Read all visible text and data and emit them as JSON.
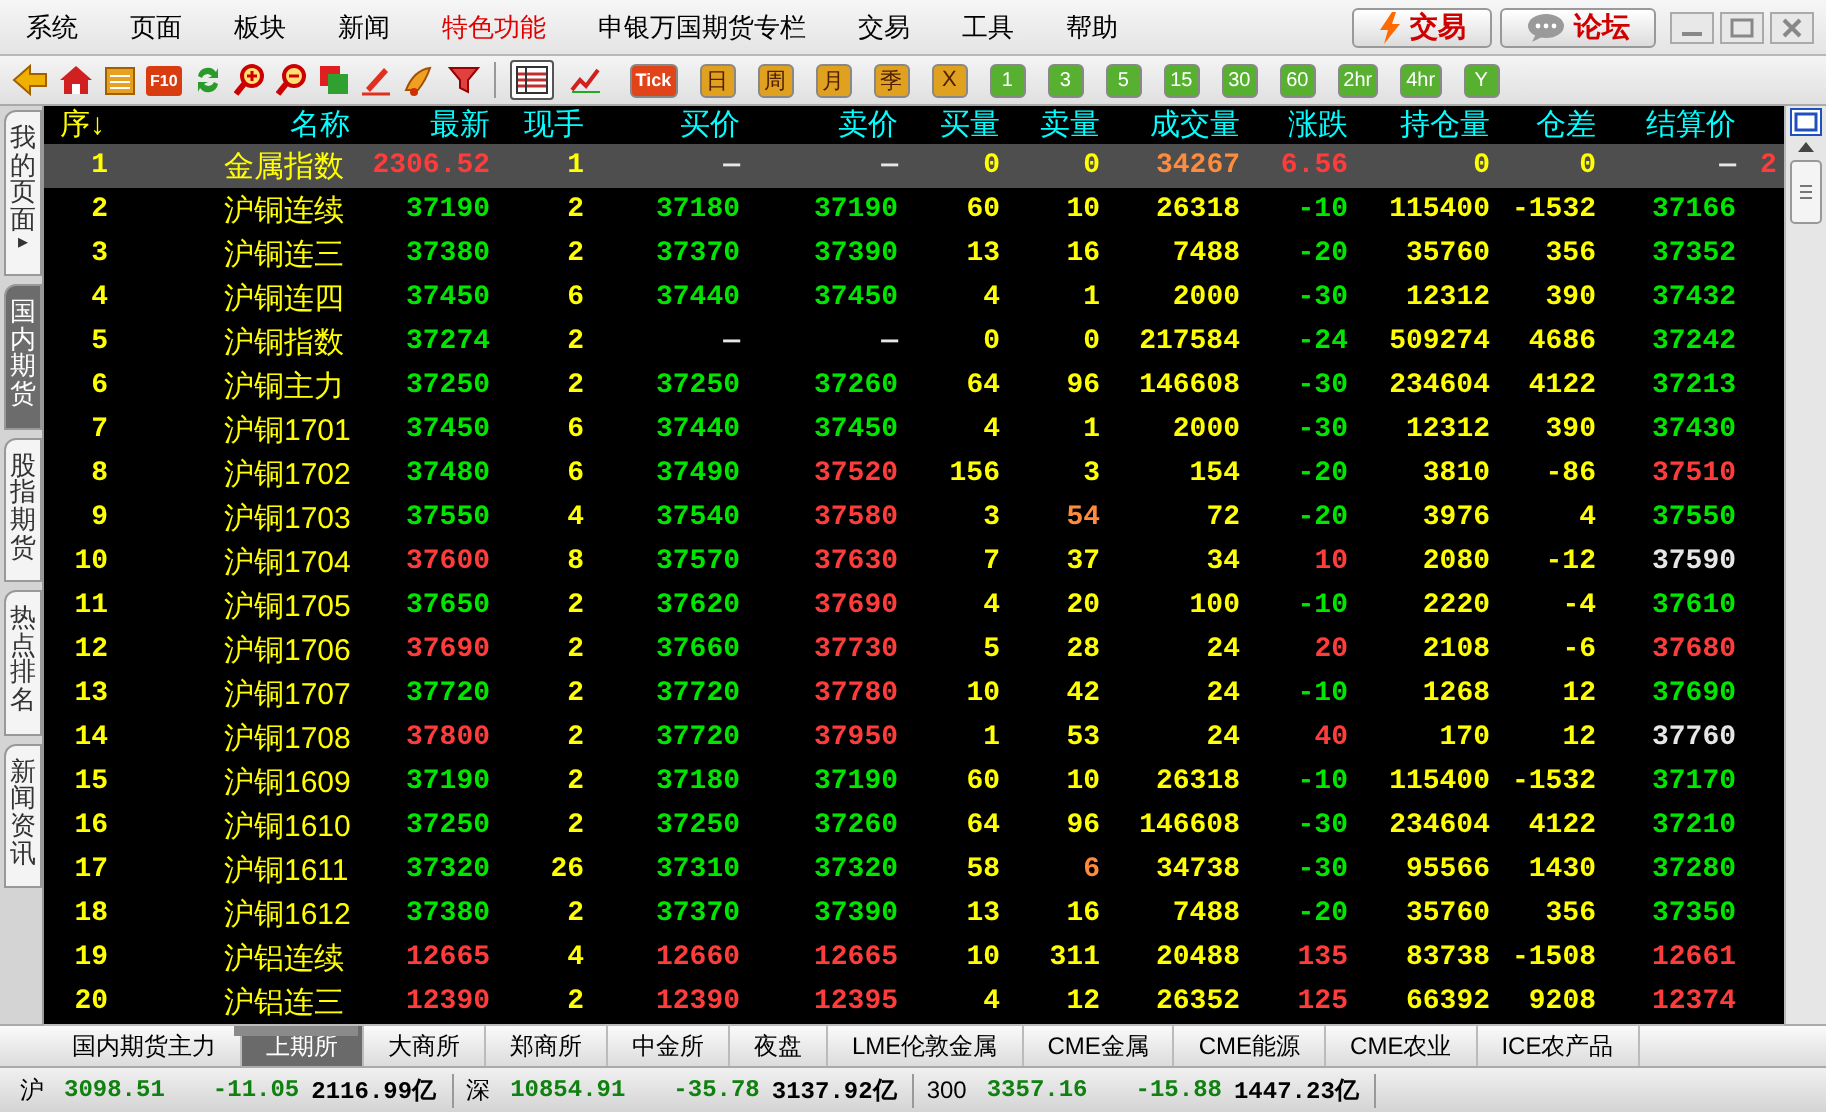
{
  "menu": [
    {
      "label": "系统",
      "highlight": false
    },
    {
      "label": "页面",
      "highlight": false
    },
    {
      "label": "板块",
      "highlight": false
    },
    {
      "label": "新闻",
      "highlight": false
    },
    {
      "label": "特色功能",
      "highlight": true
    },
    {
      "label": "申银万国期货专栏",
      "highlight": false
    },
    {
      "label": "交易",
      "highlight": false
    },
    {
      "label": "工具",
      "highlight": false
    },
    {
      "label": "帮助",
      "highlight": false
    }
  ],
  "top_buttons": [
    {
      "label": "交易",
      "kind": "trade"
    },
    {
      "label": "论坛",
      "kind": "forum"
    }
  ],
  "toolbar": {
    "f10": "F10",
    "view_buttons": [
      {
        "selected": true
      },
      {
        "selected": false
      }
    ],
    "periods": [
      {
        "label": "Tick",
        "kind": "tick"
      },
      {
        "label": "日",
        "kind": "day"
      },
      {
        "label": "周",
        "kind": "day"
      },
      {
        "label": "月",
        "kind": "day"
      },
      {
        "label": "季",
        "kind": "day"
      },
      {
        "label": "X",
        "kind": "day"
      },
      {
        "label": "1",
        "kind": "minute"
      },
      {
        "label": "3",
        "kind": "minute"
      },
      {
        "label": "5",
        "kind": "minute"
      },
      {
        "label": "15",
        "kind": "minute"
      },
      {
        "label": "30",
        "kind": "minute"
      },
      {
        "label": "60",
        "kind": "minute"
      },
      {
        "label": "2hr",
        "kind": "minute"
      },
      {
        "label": "4hr",
        "kind": "minute"
      },
      {
        "label": "Y",
        "kind": "minute"
      }
    ]
  },
  "side_tabs": [
    {
      "label": "我的页面",
      "arrow": "▸",
      "selected": false
    },
    {
      "label": "国内期货",
      "selected": true
    },
    {
      "label": "股指期货",
      "selected": false
    },
    {
      "label": "热点排名",
      "selected": false
    },
    {
      "label": "新闻资讯",
      "selected": false
    }
  ],
  "table": {
    "columns": [
      {
        "label": "序↓",
        "kind": "sort"
      },
      {
        "label": "名称",
        "kind": "field"
      },
      {
        "label": "最新",
        "kind": "field"
      },
      {
        "label": "现手",
        "kind": "field"
      },
      {
        "label": "买价",
        "kind": "field"
      },
      {
        "label": "卖价",
        "kind": "field"
      },
      {
        "label": "买量",
        "kind": "field"
      },
      {
        "label": "卖量",
        "kind": "field"
      },
      {
        "label": "成交量",
        "kind": "field"
      },
      {
        "label": "涨跌",
        "kind": "field"
      },
      {
        "label": "持仓量",
        "kind": "field"
      },
      {
        "label": "仓差",
        "kind": "field"
      },
      {
        "label": "结算价",
        "kind": "field"
      }
    ],
    "rows": [
      {
        "selected": true,
        "cells": [
          {
            "text": "1",
            "kind": "plain"
          },
          {
            "text": "金属指数",
            "kind": "plain"
          },
          {
            "text": "2306.52",
            "kind": "rise"
          },
          {
            "text": "1",
            "kind": "plain"
          },
          {
            "text": "—",
            "kind": "even"
          },
          {
            "text": "—",
            "kind": "even"
          },
          {
            "text": "0",
            "kind": "plain"
          },
          {
            "text": "0",
            "kind": "plain"
          },
          {
            "text": "34267",
            "kind": "alert"
          },
          {
            "text": "6.56",
            "kind": "rise"
          },
          {
            "text": "0",
            "kind": "plain"
          },
          {
            "text": "0",
            "kind": "plain"
          },
          {
            "text": "—",
            "kind": "even"
          },
          {
            "text": "2",
            "kind": "rise"
          }
        ]
      },
      {
        "selected": false,
        "cells": [
          {
            "text": "2",
            "kind": "plain"
          },
          {
            "text": "沪铜连续",
            "kind": "plain"
          },
          {
            "text": "37190",
            "kind": "fall"
          },
          {
            "text": "2",
            "kind": "plain"
          },
          {
            "text": "37180",
            "kind": "fall"
          },
          {
            "text": "37190",
            "kind": "fall"
          },
          {
            "text": "60",
            "kind": "plain"
          },
          {
            "text": "10",
            "kind": "plain"
          },
          {
            "text": "26318",
            "kind": "plain"
          },
          {
            "text": "-10",
            "kind": "fall"
          },
          {
            "text": "115400",
            "kind": "plain"
          },
          {
            "text": "-1532",
            "kind": "plain"
          },
          {
            "text": "37166",
            "kind": "fall"
          }
        ]
      },
      {
        "selected": false,
        "cells": [
          {
            "text": "3",
            "kind": "plain"
          },
          {
            "text": "沪铜连三",
            "kind": "plain"
          },
          {
            "text": "37380",
            "kind": "fall"
          },
          {
            "text": "2",
            "kind": "plain"
          },
          {
            "text": "37370",
            "kind": "fall"
          },
          {
            "text": "37390",
            "kind": "fall"
          },
          {
            "text": "13",
            "kind": "plain"
          },
          {
            "text": "16",
            "kind": "plain"
          },
          {
            "text": "7488",
            "kind": "plain"
          },
          {
            "text": "-20",
            "kind": "fall"
          },
          {
            "text": "35760",
            "kind": "plain"
          },
          {
            "text": "356",
            "kind": "plain"
          },
          {
            "text": "37352",
            "kind": "fall"
          }
        ]
      },
      {
        "selected": false,
        "cells": [
          {
            "text": "4",
            "kind": "plain"
          },
          {
            "text": "沪铜连四",
            "kind": "plain"
          },
          {
            "text": "37450",
            "kind": "fall"
          },
          {
            "text": "6",
            "kind": "plain"
          },
          {
            "text": "37440",
            "kind": "fall"
          },
          {
            "text": "37450",
            "kind": "fall"
          },
          {
            "text": "4",
            "kind": "plain"
          },
          {
            "text": "1",
            "kind": "plain"
          },
          {
            "text": "2000",
            "kind": "plain"
          },
          {
            "text": "-30",
            "kind": "fall"
          },
          {
            "text": "12312",
            "kind": "plain"
          },
          {
            "text": "390",
            "kind": "plain"
          },
          {
            "text": "37432",
            "kind": "fall"
          }
        ]
      },
      {
        "selected": false,
        "cells": [
          {
            "text": "5",
            "kind": "plain"
          },
          {
            "text": "沪铜指数",
            "kind": "plain"
          },
          {
            "text": "37274",
            "kind": "fall"
          },
          {
            "text": "2",
            "kind": "plain"
          },
          {
            "text": "—",
            "kind": "even"
          },
          {
            "text": "—",
            "kind": "even"
          },
          {
            "text": "0",
            "kind": "plain"
          },
          {
            "text": "0",
            "kind": "plain"
          },
          {
            "text": "217584",
            "kind": "plain"
          },
          {
            "text": "-24",
            "kind": "fall"
          },
          {
            "text": "509274",
            "kind": "plain"
          },
          {
            "text": "4686",
            "kind": "plain"
          },
          {
            "text": "37242",
            "kind": "fall"
          }
        ]
      },
      {
        "selected": false,
        "cells": [
          {
            "text": "6",
            "kind": "plain"
          },
          {
            "text": "沪铜主力",
            "kind": "plain"
          },
          {
            "text": "37250",
            "kind": "fall"
          },
          {
            "text": "2",
            "kind": "plain"
          },
          {
            "text": "37250",
            "kind": "fall"
          },
          {
            "text": "37260",
            "kind": "fall"
          },
          {
            "text": "64",
            "kind": "plain"
          },
          {
            "text": "96",
            "kind": "plain"
          },
          {
            "text": "146608",
            "kind": "plain"
          },
          {
            "text": "-30",
            "kind": "fall"
          },
          {
            "text": "234604",
            "kind": "plain"
          },
          {
            "text": "4122",
            "kind": "plain"
          },
          {
            "text": "37213",
            "kind": "fall"
          }
        ]
      },
      {
        "selected": false,
        "cells": [
          {
            "text": "7",
            "kind": "plain"
          },
          {
            "text": "沪铜1701",
            "kind": "plain"
          },
          {
            "text": "37450",
            "kind": "fall"
          },
          {
            "text": "6",
            "kind": "plain"
          },
          {
            "text": "37440",
            "kind": "fall"
          },
          {
            "text": "37450",
            "kind": "fall"
          },
          {
            "text": "4",
            "kind": "plain"
          },
          {
            "text": "1",
            "kind": "plain"
          },
          {
            "text": "2000",
            "kind": "plain"
          },
          {
            "text": "-30",
            "kind": "fall"
          },
          {
            "text": "12312",
            "kind": "plain"
          },
          {
            "text": "390",
            "kind": "plain"
          },
          {
            "text": "37430",
            "kind": "fall"
          }
        ]
      },
      {
        "selected": false,
        "cells": [
          {
            "text": "8",
            "kind": "plain"
          },
          {
            "text": "沪铜1702",
            "kind": "plain"
          },
          {
            "text": "37480",
            "kind": "fall"
          },
          {
            "text": "6",
            "kind": "plain"
          },
          {
            "text": "37490",
            "kind": "fall"
          },
          {
            "text": "37520",
            "kind": "rise"
          },
          {
            "text": "156",
            "kind": "plain"
          },
          {
            "text": "3",
            "kind": "plain"
          },
          {
            "text": "154",
            "kind": "plain"
          },
          {
            "text": "-20",
            "kind": "fall"
          },
          {
            "text": "3810",
            "kind": "plain"
          },
          {
            "text": "-86",
            "kind": "plain"
          },
          {
            "text": "37510",
            "kind": "rise"
          }
        ]
      },
      {
        "selected": false,
        "cells": [
          {
            "text": "9",
            "kind": "plain"
          },
          {
            "text": "沪铜1703",
            "kind": "plain"
          },
          {
            "text": "37550",
            "kind": "fall"
          },
          {
            "text": "4",
            "kind": "plain"
          },
          {
            "text": "37540",
            "kind": "fall"
          },
          {
            "text": "37580",
            "kind": "rise"
          },
          {
            "text": "3",
            "kind": "plain"
          },
          {
            "text": "54",
            "kind": "alert"
          },
          {
            "text": "72",
            "kind": "plain"
          },
          {
            "text": "-20",
            "kind": "fall"
          },
          {
            "text": "3976",
            "kind": "plain"
          },
          {
            "text": "4",
            "kind": "plain"
          },
          {
            "text": "37550",
            "kind": "fall"
          }
        ]
      },
      {
        "selected": false,
        "cells": [
          {
            "text": "10",
            "kind": "plain"
          },
          {
            "text": "沪铜1704",
            "kind": "plain"
          },
          {
            "text": "37600",
            "kind": "rise"
          },
          {
            "text": "8",
            "kind": "plain"
          },
          {
            "text": "37570",
            "kind": "fall"
          },
          {
            "text": "37630",
            "kind": "rise"
          },
          {
            "text": "7",
            "kind": "plain"
          },
          {
            "text": "37",
            "kind": "plain"
          },
          {
            "text": "34",
            "kind": "plain"
          },
          {
            "text": "10",
            "kind": "rise"
          },
          {
            "text": "2080",
            "kind": "plain"
          },
          {
            "text": "-12",
            "kind": "plain"
          },
          {
            "text": "37590",
            "kind": "even"
          }
        ]
      },
      {
        "selected": false,
        "cells": [
          {
            "text": "11",
            "kind": "plain"
          },
          {
            "text": "沪铜1705",
            "kind": "plain"
          },
          {
            "text": "37650",
            "kind": "fall"
          },
          {
            "text": "2",
            "kind": "plain"
          },
          {
            "text": "37620",
            "kind": "fall"
          },
          {
            "text": "37690",
            "kind": "rise"
          },
          {
            "text": "4",
            "kind": "plain"
          },
          {
            "text": "20",
            "kind": "plain"
          },
          {
            "text": "100",
            "kind": "plain"
          },
          {
            "text": "-10",
            "kind": "fall"
          },
          {
            "text": "2220",
            "kind": "plain"
          },
          {
            "text": "-4",
            "kind": "plain"
          },
          {
            "text": "37610",
            "kind": "fall"
          }
        ]
      },
      {
        "selected": false,
        "cells": [
          {
            "text": "12",
            "kind": "plain"
          },
          {
            "text": "沪铜1706",
            "kind": "plain"
          },
          {
            "text": "37690",
            "kind": "rise"
          },
          {
            "text": "2",
            "kind": "plain"
          },
          {
            "text": "37660",
            "kind": "fall"
          },
          {
            "text": "37730",
            "kind": "rise"
          },
          {
            "text": "5",
            "kind": "plain"
          },
          {
            "text": "28",
            "kind": "plain"
          },
          {
            "text": "24",
            "kind": "plain"
          },
          {
            "text": "20",
            "kind": "rise"
          },
          {
            "text": "2108",
            "kind": "plain"
          },
          {
            "text": "-6",
            "kind": "plain"
          },
          {
            "text": "37680",
            "kind": "rise"
          }
        ]
      },
      {
        "selected": false,
        "cells": [
          {
            "text": "13",
            "kind": "plain"
          },
          {
            "text": "沪铜1707",
            "kind": "plain"
          },
          {
            "text": "37720",
            "kind": "fall"
          },
          {
            "text": "2",
            "kind": "plain"
          },
          {
            "text": "37720",
            "kind": "fall"
          },
          {
            "text": "37780",
            "kind": "rise"
          },
          {
            "text": "10",
            "kind": "plain"
          },
          {
            "text": "42",
            "kind": "plain"
          },
          {
            "text": "24",
            "kind": "plain"
          },
          {
            "text": "-10",
            "kind": "fall"
          },
          {
            "text": "1268",
            "kind": "plain"
          },
          {
            "text": "12",
            "kind": "plain"
          },
          {
            "text": "37690",
            "kind": "fall"
          }
        ]
      },
      {
        "selected": false,
        "cells": [
          {
            "text": "14",
            "kind": "plain"
          },
          {
            "text": "沪铜1708",
            "kind": "plain"
          },
          {
            "text": "37800",
            "kind": "rise"
          },
          {
            "text": "2",
            "kind": "plain"
          },
          {
            "text": "37720",
            "kind": "fall"
          },
          {
            "text": "37950",
            "kind": "rise"
          },
          {
            "text": "1",
            "kind": "plain"
          },
          {
            "text": "53",
            "kind": "plain"
          },
          {
            "text": "24",
            "kind": "plain"
          },
          {
            "text": "40",
            "kind": "rise"
          },
          {
            "text": "170",
            "kind": "plain"
          },
          {
            "text": "12",
            "kind": "plain"
          },
          {
            "text": "37760",
            "kind": "even"
          }
        ]
      },
      {
        "selected": false,
        "cells": [
          {
            "text": "15",
            "kind": "plain"
          },
          {
            "text": "沪铜1609",
            "kind": "plain"
          },
          {
            "text": "37190",
            "kind": "fall"
          },
          {
            "text": "2",
            "kind": "plain"
          },
          {
            "text": "37180",
            "kind": "fall"
          },
          {
            "text": "37190",
            "kind": "fall"
          },
          {
            "text": "60",
            "kind": "plain"
          },
          {
            "text": "10",
            "kind": "plain"
          },
          {
            "text": "26318",
            "kind": "plain"
          },
          {
            "text": "-10",
            "kind": "fall"
          },
          {
            "text": "115400",
            "kind": "plain"
          },
          {
            "text": "-1532",
            "kind": "plain"
          },
          {
            "text": "37170",
            "kind": "fall"
          }
        ]
      },
      {
        "selected": false,
        "cells": [
          {
            "text": "16",
            "kind": "plain"
          },
          {
            "text": "沪铜1610",
            "kind": "plain"
          },
          {
            "text": "37250",
            "kind": "fall"
          },
          {
            "text": "2",
            "kind": "plain"
          },
          {
            "text": "37250",
            "kind": "fall"
          },
          {
            "text": "37260",
            "kind": "fall"
          },
          {
            "text": "64",
            "kind": "plain"
          },
          {
            "text": "96",
            "kind": "plain"
          },
          {
            "text": "146608",
            "kind": "plain"
          },
          {
            "text": "-30",
            "kind": "fall"
          },
          {
            "text": "234604",
            "kind": "plain"
          },
          {
            "text": "4122",
            "kind": "plain"
          },
          {
            "text": "37210",
            "kind": "fall"
          }
        ]
      },
      {
        "selected": false,
        "cells": [
          {
            "text": "17",
            "kind": "plain"
          },
          {
            "text": "沪铜1611",
            "kind": "plain"
          },
          {
            "text": "37320",
            "kind": "fall"
          },
          {
            "text": "26",
            "kind": "plain"
          },
          {
            "text": "37310",
            "kind": "fall"
          },
          {
            "text": "37320",
            "kind": "fall"
          },
          {
            "text": "58",
            "kind": "plain"
          },
          {
            "text": "6",
            "kind": "alert"
          },
          {
            "text": "34738",
            "kind": "plain"
          },
          {
            "text": "-30",
            "kind": "fall"
          },
          {
            "text": "95566",
            "kind": "plain"
          },
          {
            "text": "1430",
            "kind": "plain"
          },
          {
            "text": "37280",
            "kind": "fall"
          }
        ]
      },
      {
        "selected": false,
        "cells": [
          {
            "text": "18",
            "kind": "plain"
          },
          {
            "text": "沪铜1612",
            "kind": "plain"
          },
          {
            "text": "37380",
            "kind": "fall"
          },
          {
            "text": "2",
            "kind": "plain"
          },
          {
            "text": "37370",
            "kind": "fall"
          },
          {
            "text": "37390",
            "kind": "fall"
          },
          {
            "text": "13",
            "kind": "plain"
          },
          {
            "text": "16",
            "kind": "plain"
          },
          {
            "text": "7488",
            "kind": "plain"
          },
          {
            "text": "-20",
            "kind": "fall"
          },
          {
            "text": "35760",
            "kind": "plain"
          },
          {
            "text": "356",
            "kind": "plain"
          },
          {
            "text": "37350",
            "kind": "fall"
          }
        ]
      },
      {
        "selected": false,
        "cells": [
          {
            "text": "19",
            "kind": "plain"
          },
          {
            "text": "沪铝连续",
            "kind": "plain"
          },
          {
            "text": "12665",
            "kind": "rise"
          },
          {
            "text": "4",
            "kind": "plain"
          },
          {
            "text": "12660",
            "kind": "rise"
          },
          {
            "text": "12665",
            "kind": "rise"
          },
          {
            "text": "10",
            "kind": "plain"
          },
          {
            "text": "311",
            "kind": "plain"
          },
          {
            "text": "20488",
            "kind": "plain"
          },
          {
            "text": "135",
            "kind": "rise"
          },
          {
            "text": "83738",
            "kind": "plain"
          },
          {
            "text": "-1508",
            "kind": "plain"
          },
          {
            "text": "12661",
            "kind": "rise"
          }
        ]
      },
      {
        "selected": false,
        "cells": [
          {
            "text": "20",
            "kind": "plain"
          },
          {
            "text": "沪铝连三",
            "kind": "plain"
          },
          {
            "text": "12390",
            "kind": "rise"
          },
          {
            "text": "2",
            "kind": "plain"
          },
          {
            "text": "12390",
            "kind": "rise"
          },
          {
            "text": "12395",
            "kind": "rise"
          },
          {
            "text": "4",
            "kind": "plain"
          },
          {
            "text": "12",
            "kind": "plain"
          },
          {
            "text": "26352",
            "kind": "plain"
          },
          {
            "text": "125",
            "kind": "rise"
          },
          {
            "text": "66392",
            "kind": "plain"
          },
          {
            "text": "9208",
            "kind": "plain"
          },
          {
            "text": "12374",
            "kind": "rise"
          }
        ]
      }
    ]
  },
  "bottom_tabs": [
    {
      "label": "国内期货主力",
      "selected": false
    },
    {
      "label": "上期所",
      "selected": true
    },
    {
      "label": "大商所",
      "selected": false
    },
    {
      "label": "郑商所",
      "selected": false
    },
    {
      "label": "中金所",
      "selected": false
    },
    {
      "label": "夜盘",
      "selected": false
    },
    {
      "label": "LME伦敦金属",
      "selected": false
    },
    {
      "label": "CME金属",
      "selected": false
    },
    {
      "label": "CME能源",
      "selected": false
    },
    {
      "label": "CME农业",
      "selected": false
    },
    {
      "label": "ICE农产品",
      "selected": false
    }
  ],
  "status_bar": [
    {
      "name": "沪",
      "value": "3098.51",
      "change": "-11.05",
      "amount": "2116.99亿"
    },
    {
      "name": "深",
      "value": "10854.91",
      "change": "-35.78",
      "amount": "3137.92亿"
    },
    {
      "name": "300",
      "value": "3357.16",
      "change": "-15.88",
      "amount": "1447.23亿"
    }
  ]
}
